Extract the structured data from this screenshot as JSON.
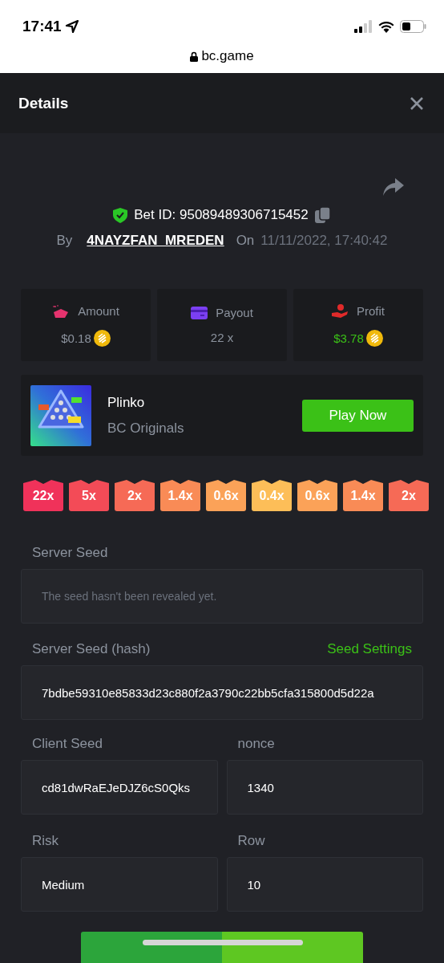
{
  "status_bar": {
    "time": "17:41"
  },
  "address_bar": {
    "url": "bc.game"
  },
  "header": {
    "title": "Details"
  },
  "bet": {
    "id_label": "Bet ID: 95089489306715452",
    "by_label": "By",
    "user": "4NAYZFAN_MREDEN",
    "on_label": "On",
    "date": "11/11/2022, 17:40:42"
  },
  "stats": [
    {
      "kind": "amount",
      "label": "Amount",
      "value": "$0.18",
      "coin": true,
      "positive": false
    },
    {
      "kind": "payout",
      "label": "Payout",
      "value": "22 x",
      "coin": false,
      "positive": false
    },
    {
      "kind": "profit",
      "label": "Profit",
      "value": "$3.78",
      "coin": true,
      "positive": true
    }
  ],
  "game": {
    "name": "Plinko",
    "provider": "BC Originals",
    "button": "Play Now"
  },
  "multipliers": [
    {
      "label": "22x",
      "color": "#f0325a"
    },
    {
      "label": "5x",
      "color": "#f34b57"
    },
    {
      "label": "2x",
      "color": "#f66a56"
    },
    {
      "label": "1.4x",
      "color": "#f98b56"
    },
    {
      "label": "0.6x",
      "color": "#fba258"
    },
    {
      "label": "0.4x",
      "color": "#fdbe58"
    },
    {
      "label": "0.6x",
      "color": "#fba258"
    },
    {
      "label": "1.4x",
      "color": "#f98b56"
    },
    {
      "label": "2x",
      "color": "#f66a56"
    }
  ],
  "server_seed": {
    "label": "Server Seed",
    "placeholder": "The seed hasn't been revealed yet."
  },
  "server_seed_hash": {
    "label": "Server Seed (hash)",
    "link": "Seed Settings",
    "value": "7bdbe59310e85833d23c880f2a3790c22bb5cfa315800d5d22a"
  },
  "fields": [
    {
      "label": "Client Seed",
      "value": "cd81dwRaEJeDJZ6cS0Qks"
    },
    {
      "label": "nonce",
      "value": "1340"
    },
    {
      "label": "Risk",
      "value": "Medium"
    },
    {
      "label": "Row",
      "value": "10"
    }
  ]
}
